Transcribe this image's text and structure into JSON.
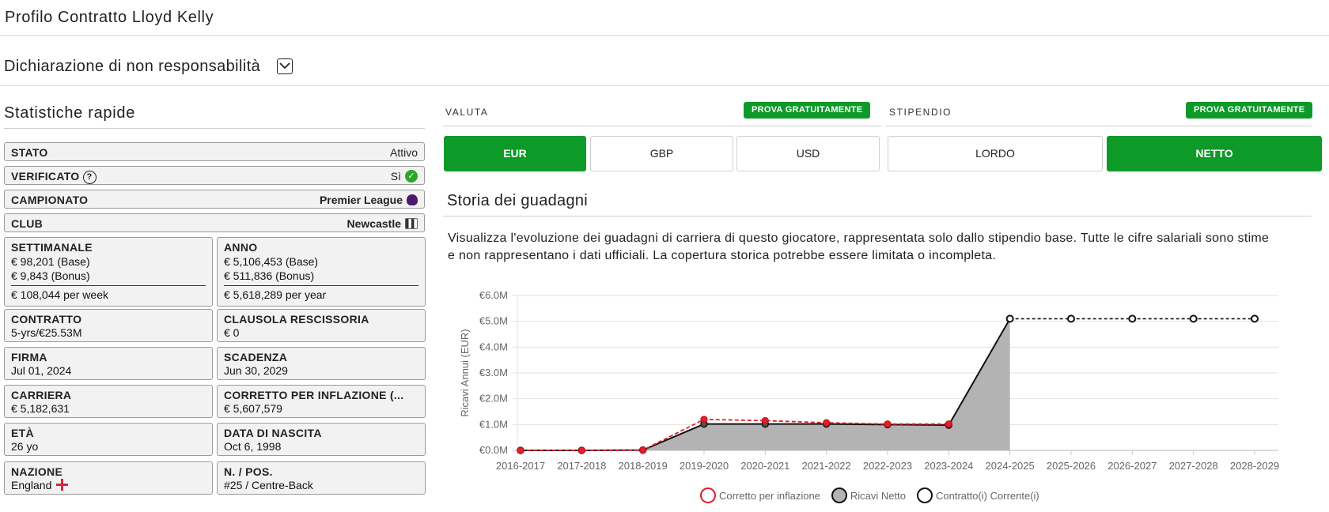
{
  "header": {
    "title": "Profilo Contratto Lloyd Kelly"
  },
  "disclaimer": {
    "label": "Dichiarazione di non responsabilità",
    "toggle_icon": "chevron-down-icon"
  },
  "quick_stats": {
    "title": "Statistiche rapide",
    "rows": [
      {
        "key": "STATO",
        "value": "Attivo"
      },
      {
        "key": "VERIFICATO",
        "value": "Sì"
      },
      {
        "key": "CAMPIONATO",
        "value": "Premier League"
      },
      {
        "key": "CLUB",
        "value": "Newcastle"
      }
    ],
    "weekly": {
      "key": "SETTIMANALE",
      "base": "€ 98,201 (Base)",
      "bonus": "€ 9,843 (Bonus)",
      "total": "€ 108,044 per week"
    },
    "annual": {
      "key": "ANNO",
      "base": "€ 5,106,453 (Base)",
      "bonus": "€ 511,836 (Bonus)",
      "total": "€ 5,618,289 per year"
    },
    "cards": [
      {
        "key": "CONTRATTO",
        "value": "5-yrs/€25.53M"
      },
      {
        "key": "CLAUSOLA RESCISSORIA",
        "value": "€ 0"
      },
      {
        "key": "FIRMA",
        "value": "Jul 01, 2024"
      },
      {
        "key": "SCADENZA",
        "value": "Jun 30, 2029"
      },
      {
        "key": "CARRIERA",
        "value": "€ 5,182,631"
      },
      {
        "key": "CORRETTO PER INFLAZIONE (...",
        "value": "€ 5,607,579"
      },
      {
        "key": "ETÀ",
        "value": "26 yo"
      },
      {
        "key": "DATA DI NASCITA",
        "value": "Oct 6, 1998"
      },
      {
        "key": "NAZIONE",
        "value": "England"
      },
      {
        "key": "N. / POS.",
        "value": "#25 / Centre-Back"
      }
    ]
  },
  "currency": {
    "label": "VALUTA",
    "try_label": "PROVA GRATUITAMENTE",
    "options": [
      "EUR",
      "GBP",
      "USD"
    ],
    "selected": "EUR"
  },
  "salary": {
    "label": "STIPENDIO",
    "try_label": "PROVA GRATUITAMENTE",
    "options": [
      "LORDO",
      "NETTO"
    ],
    "selected": "NETTO"
  },
  "history": {
    "title": "Storia dei guadagni",
    "description": "Visualizza l'evoluzione dei guadagni di carriera di questo giocatore, rappresentata solo dallo stipendio base. Tutte le cifre salariali sono stime e non rappresentano i dati ufficiali. La copertura storica potrebbe essere limitata o incompleta."
  },
  "colors": {
    "accent": "#0e9a28",
    "inflation": "#e0202a",
    "net_fill": "#b3b3b3",
    "contract": "#111111"
  },
  "chart_data": {
    "type": "line",
    "ylabel": "Ricavi Annui (EUR)",
    "ylim": [
      0,
      6
    ],
    "yticks": [
      "€0.0M",
      "€1.0M",
      "€2.0M",
      "€3.0M",
      "€4.0M",
      "€5.0M",
      "€6.0M"
    ],
    "categories": [
      "2016-2017",
      "2017-2018",
      "2018-2019",
      "2019-2020",
      "2020-2021",
      "2021-2022",
      "2022-2023",
      "2023-2024",
      "2024-2025",
      "2025-2026",
      "2026-2027",
      "2027-2028",
      "2028-2029"
    ],
    "series": [
      {
        "name": "Corretto per inflazione",
        "values": [
          0,
          0,
          0.01,
          1.2,
          1.15,
          1.07,
          1.02,
          1.02,
          null,
          null,
          null,
          null,
          null
        ]
      },
      {
        "name": "Ricavi Netto",
        "values": [
          0,
          0,
          0.01,
          1.02,
          1.02,
          1.02,
          1.0,
          0.98,
          5.1,
          null,
          null,
          null,
          null
        ]
      },
      {
        "name": "Contratto(i) Corrente(i)",
        "values": [
          null,
          null,
          null,
          null,
          null,
          null,
          null,
          null,
          5.1,
          5.1,
          5.1,
          5.1,
          5.1
        ]
      }
    ],
    "legend_position": "bottom",
    "grid": true
  }
}
